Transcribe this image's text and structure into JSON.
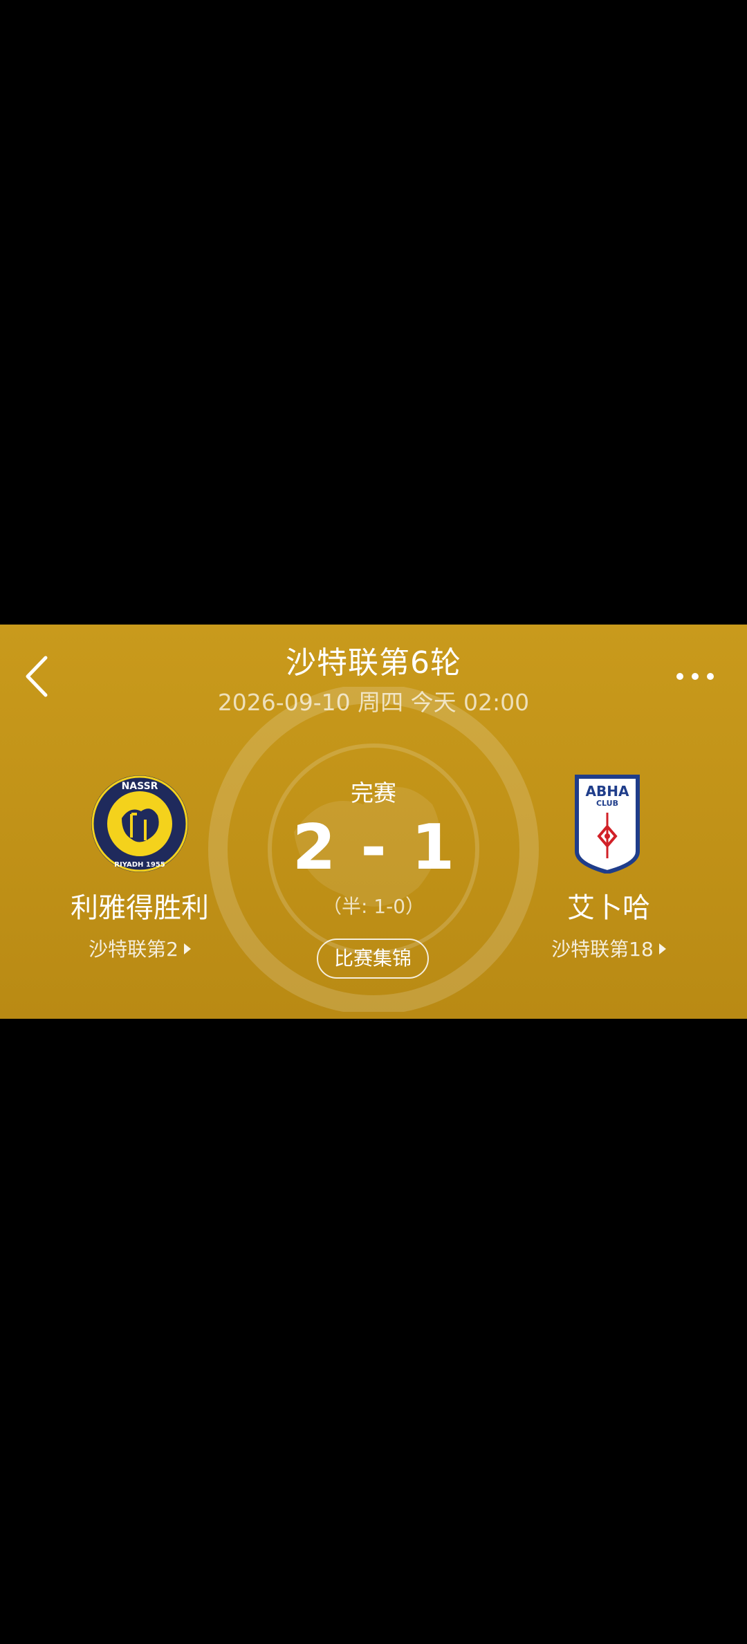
{
  "header": {
    "title": "沙特联第6轮",
    "datetime": "2026-09-10 周四 今天 02:00"
  },
  "match": {
    "status": "完赛",
    "score_home": "2",
    "score_separator": "-",
    "score_away": "1",
    "halftime": "（半: 1-0）",
    "highlights_label": "比赛集锦"
  },
  "home_team": {
    "name": "利雅得胜利",
    "rank": "沙特联第2",
    "logo_text_top": "NASSR",
    "logo_text_bottom": "RIYADH 1955",
    "colors": {
      "primary": "#1f2a5c",
      "secondary": "#f4d21c"
    }
  },
  "away_team": {
    "name": "艾卜哈",
    "rank": "沙特联第18",
    "logo_text_top": "ABHA",
    "logo_text_bottom": "CLUB",
    "colors": {
      "primary": "#1f3d8a",
      "accent": "#d12027",
      "base": "#ffffff"
    }
  },
  "icons": {
    "back": "chevron-left-icon",
    "more": "more-dots-icon",
    "rank_arrow": "triangle-right-icon"
  },
  "theme": {
    "card_background": "#c59616",
    "page_background": "#000000"
  }
}
